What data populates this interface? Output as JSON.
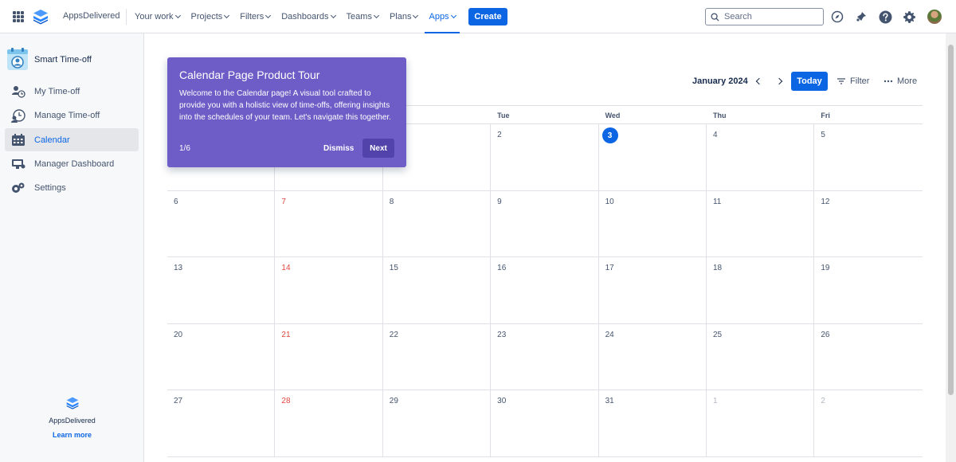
{
  "header": {
    "brand": "AppsDelivered",
    "nav": [
      {
        "label": "Your work"
      },
      {
        "label": "Projects"
      },
      {
        "label": "Filters"
      },
      {
        "label": "Dashboards"
      },
      {
        "label": "Teams"
      },
      {
        "label": "Plans"
      },
      {
        "label": "Apps",
        "active": true
      }
    ],
    "create_label": "Create",
    "search_placeholder": "Search",
    "accent_color": "#0c66e4"
  },
  "sidebar": {
    "title": "Smart Time-off",
    "items": [
      {
        "label": "My Time-off",
        "icon": "user-clock-icon"
      },
      {
        "label": "Manage Time-off",
        "icon": "team-clock-icon"
      },
      {
        "label": "Calendar",
        "icon": "calendar-icon",
        "selected": true
      },
      {
        "label": "Manager Dashboard",
        "icon": "dashboard-icon"
      },
      {
        "label": "Settings",
        "icon": "gears-icon"
      }
    ],
    "footer": {
      "name": "AppsDelivered",
      "link": "Learn more"
    }
  },
  "calendar": {
    "month_label": "January 2024",
    "today_label": "Today",
    "filter_label": "Filter",
    "more_label": "More",
    "weekdays": [
      "",
      "",
      "",
      "Tue",
      "Wed",
      "Thu",
      "Fri"
    ],
    "weeks": [
      [
        {
          "num": ""
        },
        {
          "num": "",
          "weekend": true
        },
        {
          "num": ""
        },
        {
          "num": "2"
        },
        {
          "num": "3",
          "today": true
        },
        {
          "num": "4"
        },
        {
          "num": "5"
        }
      ],
      [
        {
          "num": "6"
        },
        {
          "num": "7",
          "weekend": true
        },
        {
          "num": "8"
        },
        {
          "num": "9"
        },
        {
          "num": "10"
        },
        {
          "num": "11"
        },
        {
          "num": "12"
        }
      ],
      [
        {
          "num": "13"
        },
        {
          "num": "14",
          "weekend": true
        },
        {
          "num": "15"
        },
        {
          "num": "16"
        },
        {
          "num": "17"
        },
        {
          "num": "18"
        },
        {
          "num": "19"
        }
      ],
      [
        {
          "num": "20"
        },
        {
          "num": "21",
          "weekend": true
        },
        {
          "num": "22"
        },
        {
          "num": "23"
        },
        {
          "num": "24"
        },
        {
          "num": "25"
        },
        {
          "num": "26"
        }
      ],
      [
        {
          "num": "27"
        },
        {
          "num": "28",
          "weekend": true
        },
        {
          "num": "29"
        },
        {
          "num": "30"
        },
        {
          "num": "31"
        },
        {
          "num": "1",
          "muted": true
        },
        {
          "num": "2",
          "muted": true
        }
      ]
    ]
  },
  "tour": {
    "title": "Calendar Page Product Tour",
    "body": "Welcome to the Calendar page! A visual tool crafted to provide you with a holistic view of time-offs, offering insights into the schedules of your team. Let's navigate this together.",
    "step": "1/6",
    "dismiss_label": "Dismiss",
    "next_label": "Next",
    "color": "#6e5dc6"
  }
}
